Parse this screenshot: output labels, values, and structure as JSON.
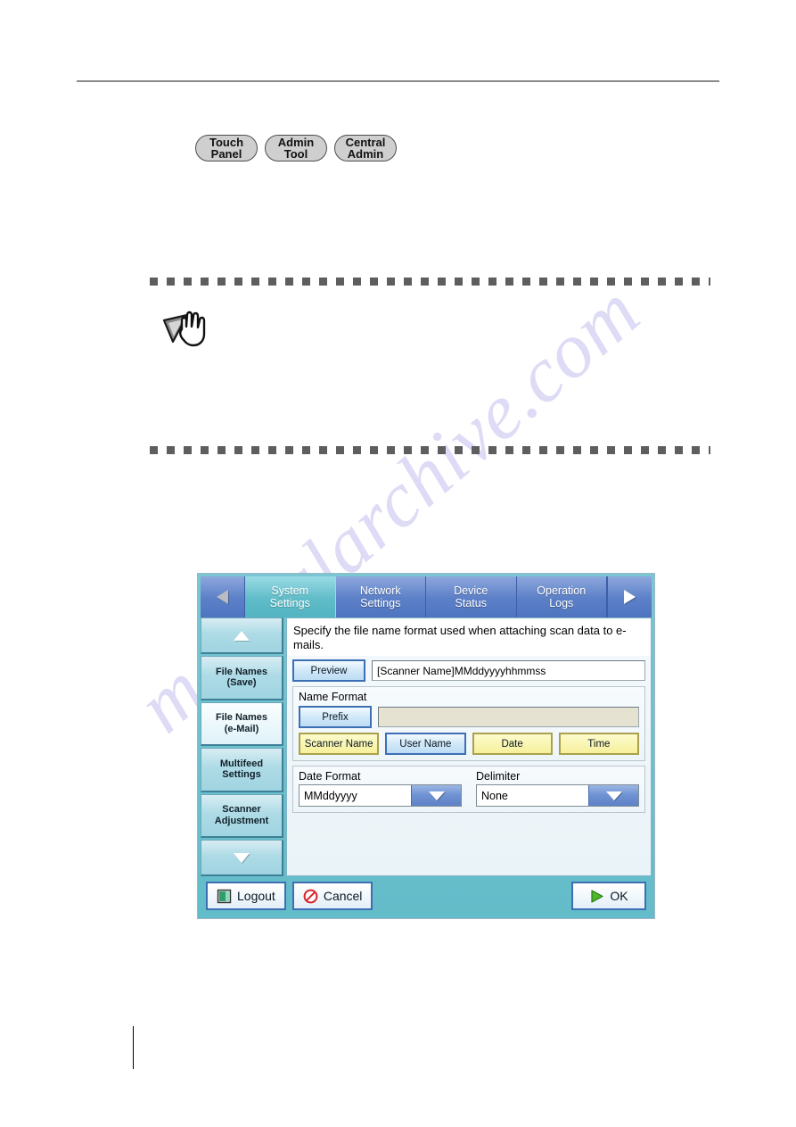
{
  "document": {
    "watermark_text": "manualarchive.com"
  },
  "legend_chips": [
    {
      "line1": "Touch",
      "line2": "Panel",
      "name": "touch-panel"
    },
    {
      "line1": "Admin",
      "line2": "Tool",
      "name": "admin-tool"
    },
    {
      "line1": "Central",
      "line2": "Admin",
      "name": "central-admin"
    }
  ],
  "note": {
    "icon": "hint-hand-icon"
  },
  "panel": {
    "nav": {
      "prev_icon": "triangle-left-icon",
      "next_icon": "triangle-right-icon"
    },
    "tabs": [
      {
        "line1": "System",
        "line2": "Settings",
        "active": true
      },
      {
        "line1": "Network",
        "line2": "Settings",
        "active": false
      },
      {
        "line1": "Device",
        "line2": "Status",
        "active": false
      },
      {
        "line1": "Operation",
        "line2": "Logs",
        "active": false
      }
    ],
    "sidebar": {
      "scroll_up_icon": "triangle-up-icon",
      "scroll_down_icon": "triangle-down-icon",
      "items": [
        {
          "line1": "File Names",
          "line2": "(Save)",
          "selected": false
        },
        {
          "line1": "File Names",
          "line2": "(e-Mail)",
          "selected": true
        },
        {
          "line1": "Multifeed",
          "line2": "Settings",
          "selected": false
        },
        {
          "line1": "Scanner",
          "line2": "Adjustment",
          "selected": false
        }
      ]
    },
    "instruction": "Specify the file name format used when attaching scan data to e-mails.",
    "preview": {
      "button_label": "Preview",
      "value": "[Scanner Name]MMddyyyyhhmmss"
    },
    "name_format": {
      "title": "Name Format",
      "prefix_button_label": "Prefix",
      "prefix_value": "",
      "tokens": [
        {
          "label": "Scanner Name",
          "style": "yellow"
        },
        {
          "label": "User Name",
          "style": "blue"
        },
        {
          "label": "Date",
          "style": "yellow"
        },
        {
          "label": "Time",
          "style": "yellow"
        }
      ]
    },
    "date_format": {
      "label": "Date Format",
      "value": "MMddyyyy",
      "dropdown_icon": "chevron-down-icon"
    },
    "delimiter": {
      "label": "Delimiter",
      "value": "None",
      "dropdown_icon": "chevron-down-icon"
    },
    "actions": {
      "logout_label": "Logout",
      "logout_icon": "door-exit-icon",
      "cancel_label": "Cancel",
      "cancel_icon": "no-entry-icon",
      "ok_label": "OK",
      "ok_icon": "play-triangle-icon"
    }
  },
  "colors": {
    "panel_frame": "#63bcc9",
    "tab_active": "#5fbcc8",
    "tab_inactive": "#5d81c8",
    "token_yellow": "#f6f09b",
    "token_blue": "#bcdcf4",
    "prefix_field": "#e6e2d2"
  }
}
